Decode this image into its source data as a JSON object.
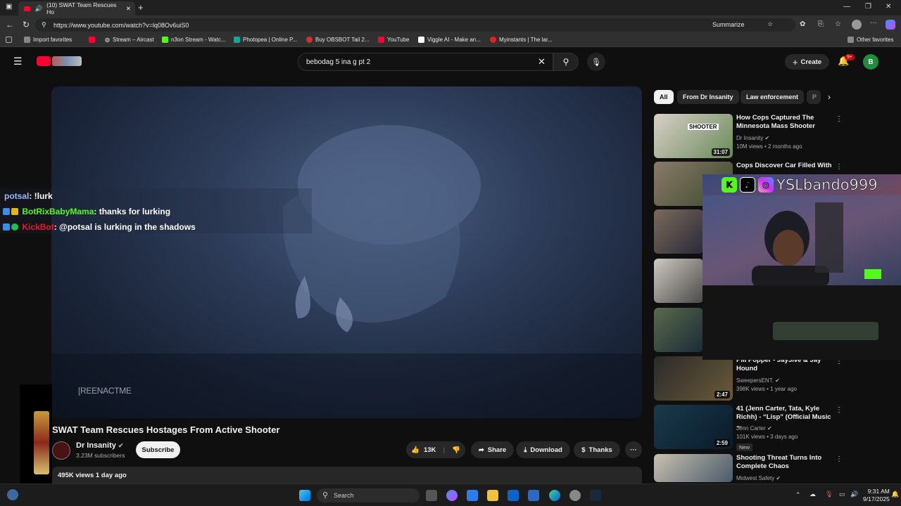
{
  "browser": {
    "tab_title": "(10) SWAT Team Rescues Ho",
    "url": "https://www.youtube.com/watch?v=lq08Ov6uiS0",
    "summarize_label": "Summarize",
    "favorites": [
      {
        "label": "Import favorites",
        "color": "#888"
      },
      {
        "label": "Stream – Aircast",
        "color": "#ff0033"
      },
      {
        "label": "n3on Stream - Watc...",
        "color": "#53fc18"
      },
      {
        "label": "Photopea | Online P...",
        "color": "#18a497"
      },
      {
        "label": "Buy OBSBOT Tail 2...",
        "color": "#c33"
      },
      {
        "label": "YouTube",
        "color": "#ff0033"
      },
      {
        "label": "Viggle AI - Make an...",
        "color": "#fff"
      },
      {
        "label": "Myinstants | The lar...",
        "color": "#d22"
      }
    ],
    "other_favorites": "Other favorites"
  },
  "youtube": {
    "search_value": "bebodag 5 ina g pt 2",
    "create_label": "Create",
    "notif_count": "9+",
    "avatar_letter": "B"
  },
  "video": {
    "overlay_text": "[REENACTME",
    "title": "SWAT Team Rescues Hostages From Active Shooter",
    "channel": "Dr Insanity",
    "subscribers": "3.23M subscribers",
    "subscribe_label": "Subscribe",
    "likes": "13K",
    "share_label": "Share",
    "download_label": "Download",
    "thanks_label": "Thanks",
    "views_date": "495K views  1 day ago"
  },
  "chat": [
    {
      "user": "potsal",
      "msg": ": !lurk",
      "user_color": "#9ab8ff"
    },
    {
      "user": "BotRixBabyMama",
      "msg": ": thanks for lurking",
      "user_color": "#53fc18"
    },
    {
      "user": "KickBot",
      "msg": ": @potsal is lurking in the shadows",
      "user_color": "#e8162c"
    }
  ],
  "chips": [
    "All",
    "From Dr Insanity",
    "Law enforcement",
    "P"
  ],
  "recommendations": [
    {
      "title": "How Cops Captured The Minnesota Mass Shooter",
      "channel": "Dr Insanity",
      "meta": "10M views • 2 months ago",
      "duration": "31:07",
      "thumb_text": "SHOOTER"
    },
    {
      "title": "Cops Discover Car Filled With",
      "channel": "",
      "meta": "",
      "duration": "",
      "thumb_text": ""
    },
    {
      "title": "Pill Popper - Jay5ive & Jay Hound",
      "channel": "SweepersENT.",
      "meta": "398K views • 1 year ago",
      "duration": "2:47",
      "thumb_text": ""
    },
    {
      "title": "41 (Jenn Carter, Tata, Kyle Richh) - “Lisp” (Official Music ...",
      "channel": "Jenn Carter",
      "meta": "101K views • 3 days ago",
      "duration": "2:59",
      "badge": "New",
      "thumb_text": ""
    },
    {
      "title": "Shooting Threat Turns Into Complete Chaos",
      "channel": "Midwest Safety",
      "meta": "",
      "duration": "",
      "thumb_text": ""
    }
  ],
  "webcam": {
    "handle": "YSLbando999"
  },
  "taskbar": {
    "search_placeholder": "Search",
    "time": "9:31 AM",
    "date": "9/17/2025"
  }
}
